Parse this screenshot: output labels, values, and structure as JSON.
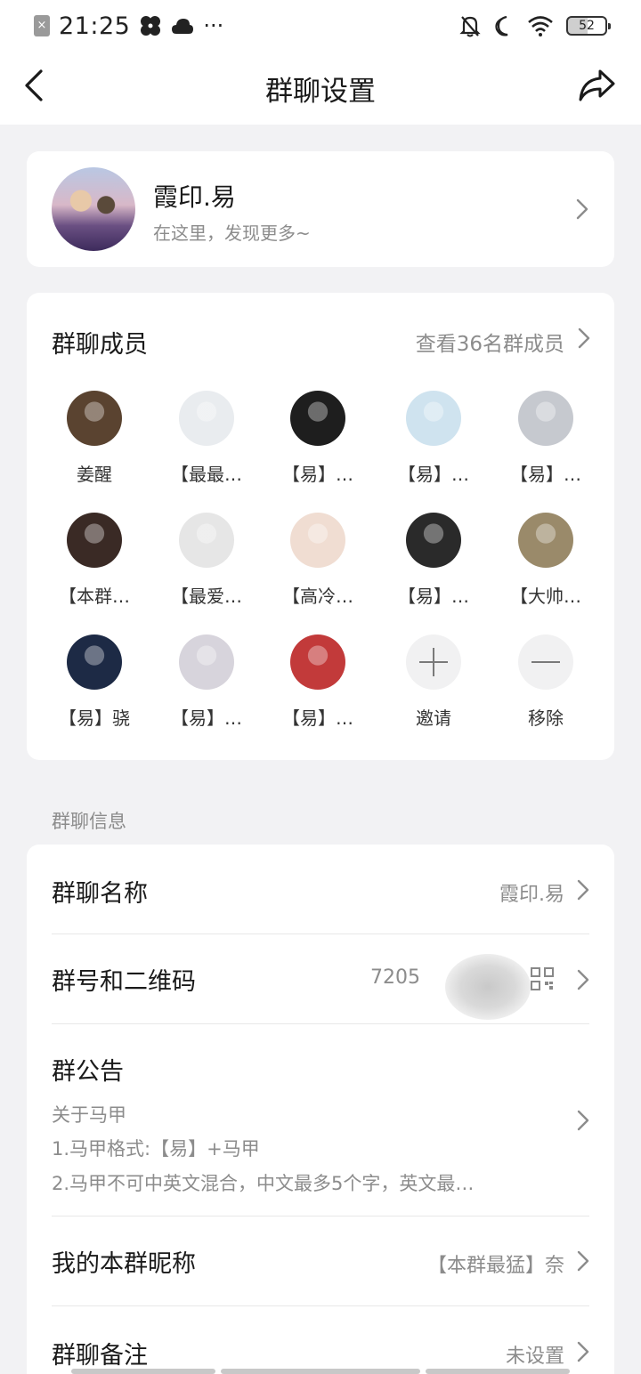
{
  "status_bar": {
    "time": "21:25",
    "dots": "···",
    "battery": "52",
    "left_icons": [
      "close-notification-icon",
      "fan-icon",
      "cloud-icon"
    ],
    "right_icons": [
      "bell-off-icon",
      "moon-icon",
      "wifi-icon",
      "battery-icon"
    ]
  },
  "nav": {
    "title": "群聊设置",
    "back_icon": "chevron-left-icon",
    "share_icon": "share-icon"
  },
  "group": {
    "name": "霞印.易",
    "subtitle": "在这里，发现更多~"
  },
  "members": {
    "title": "群聊成员",
    "view_all": "查看36名群成员",
    "list": [
      {
        "name": "姜醒",
        "color": "#5a4330"
      },
      {
        "name": "【最最…",
        "color": "#e9ecef"
      },
      {
        "name": "【易】…",
        "color": "#1e1e1e"
      },
      {
        "name": "【易】…",
        "color": "#cfe3ef"
      },
      {
        "name": "【易】…",
        "color": "#c6c9cf"
      },
      {
        "name": "【本群…",
        "color": "#3a2a25"
      },
      {
        "name": "【最爱…",
        "color": "#e6e6e6"
      },
      {
        "name": "【高冷…",
        "color": "#f0ddd2"
      },
      {
        "name": "【易】…",
        "color": "#2a2a2a"
      },
      {
        "name": "【大帅…",
        "color": "#9a8a6a"
      },
      {
        "name": "【易】骁",
        "color": "#1d2a45"
      },
      {
        "name": "【易】…",
        "color": "#d7d4dc"
      },
      {
        "name": "【易】…",
        "color": "#c23a3a"
      }
    ],
    "invite_label": "邀请",
    "remove_label": "移除"
  },
  "section_label": "群聊信息",
  "info": {
    "name_title": "群聊名称",
    "name_value": "霞印.易",
    "number_title": "群号和二维码",
    "number_value": "7205",
    "notice_title": "群公告",
    "notice_lines": [
      "关于马甲",
      "1.马甲格式:【易】+马甲",
      "2.马甲不可中英文混合，中文最多5个字，英文最…"
    ],
    "nickname_title": "我的本群昵称",
    "nickname_value": "【本群最猛】奈",
    "remark_title": "群聊备注",
    "remark_value": "未设置"
  }
}
